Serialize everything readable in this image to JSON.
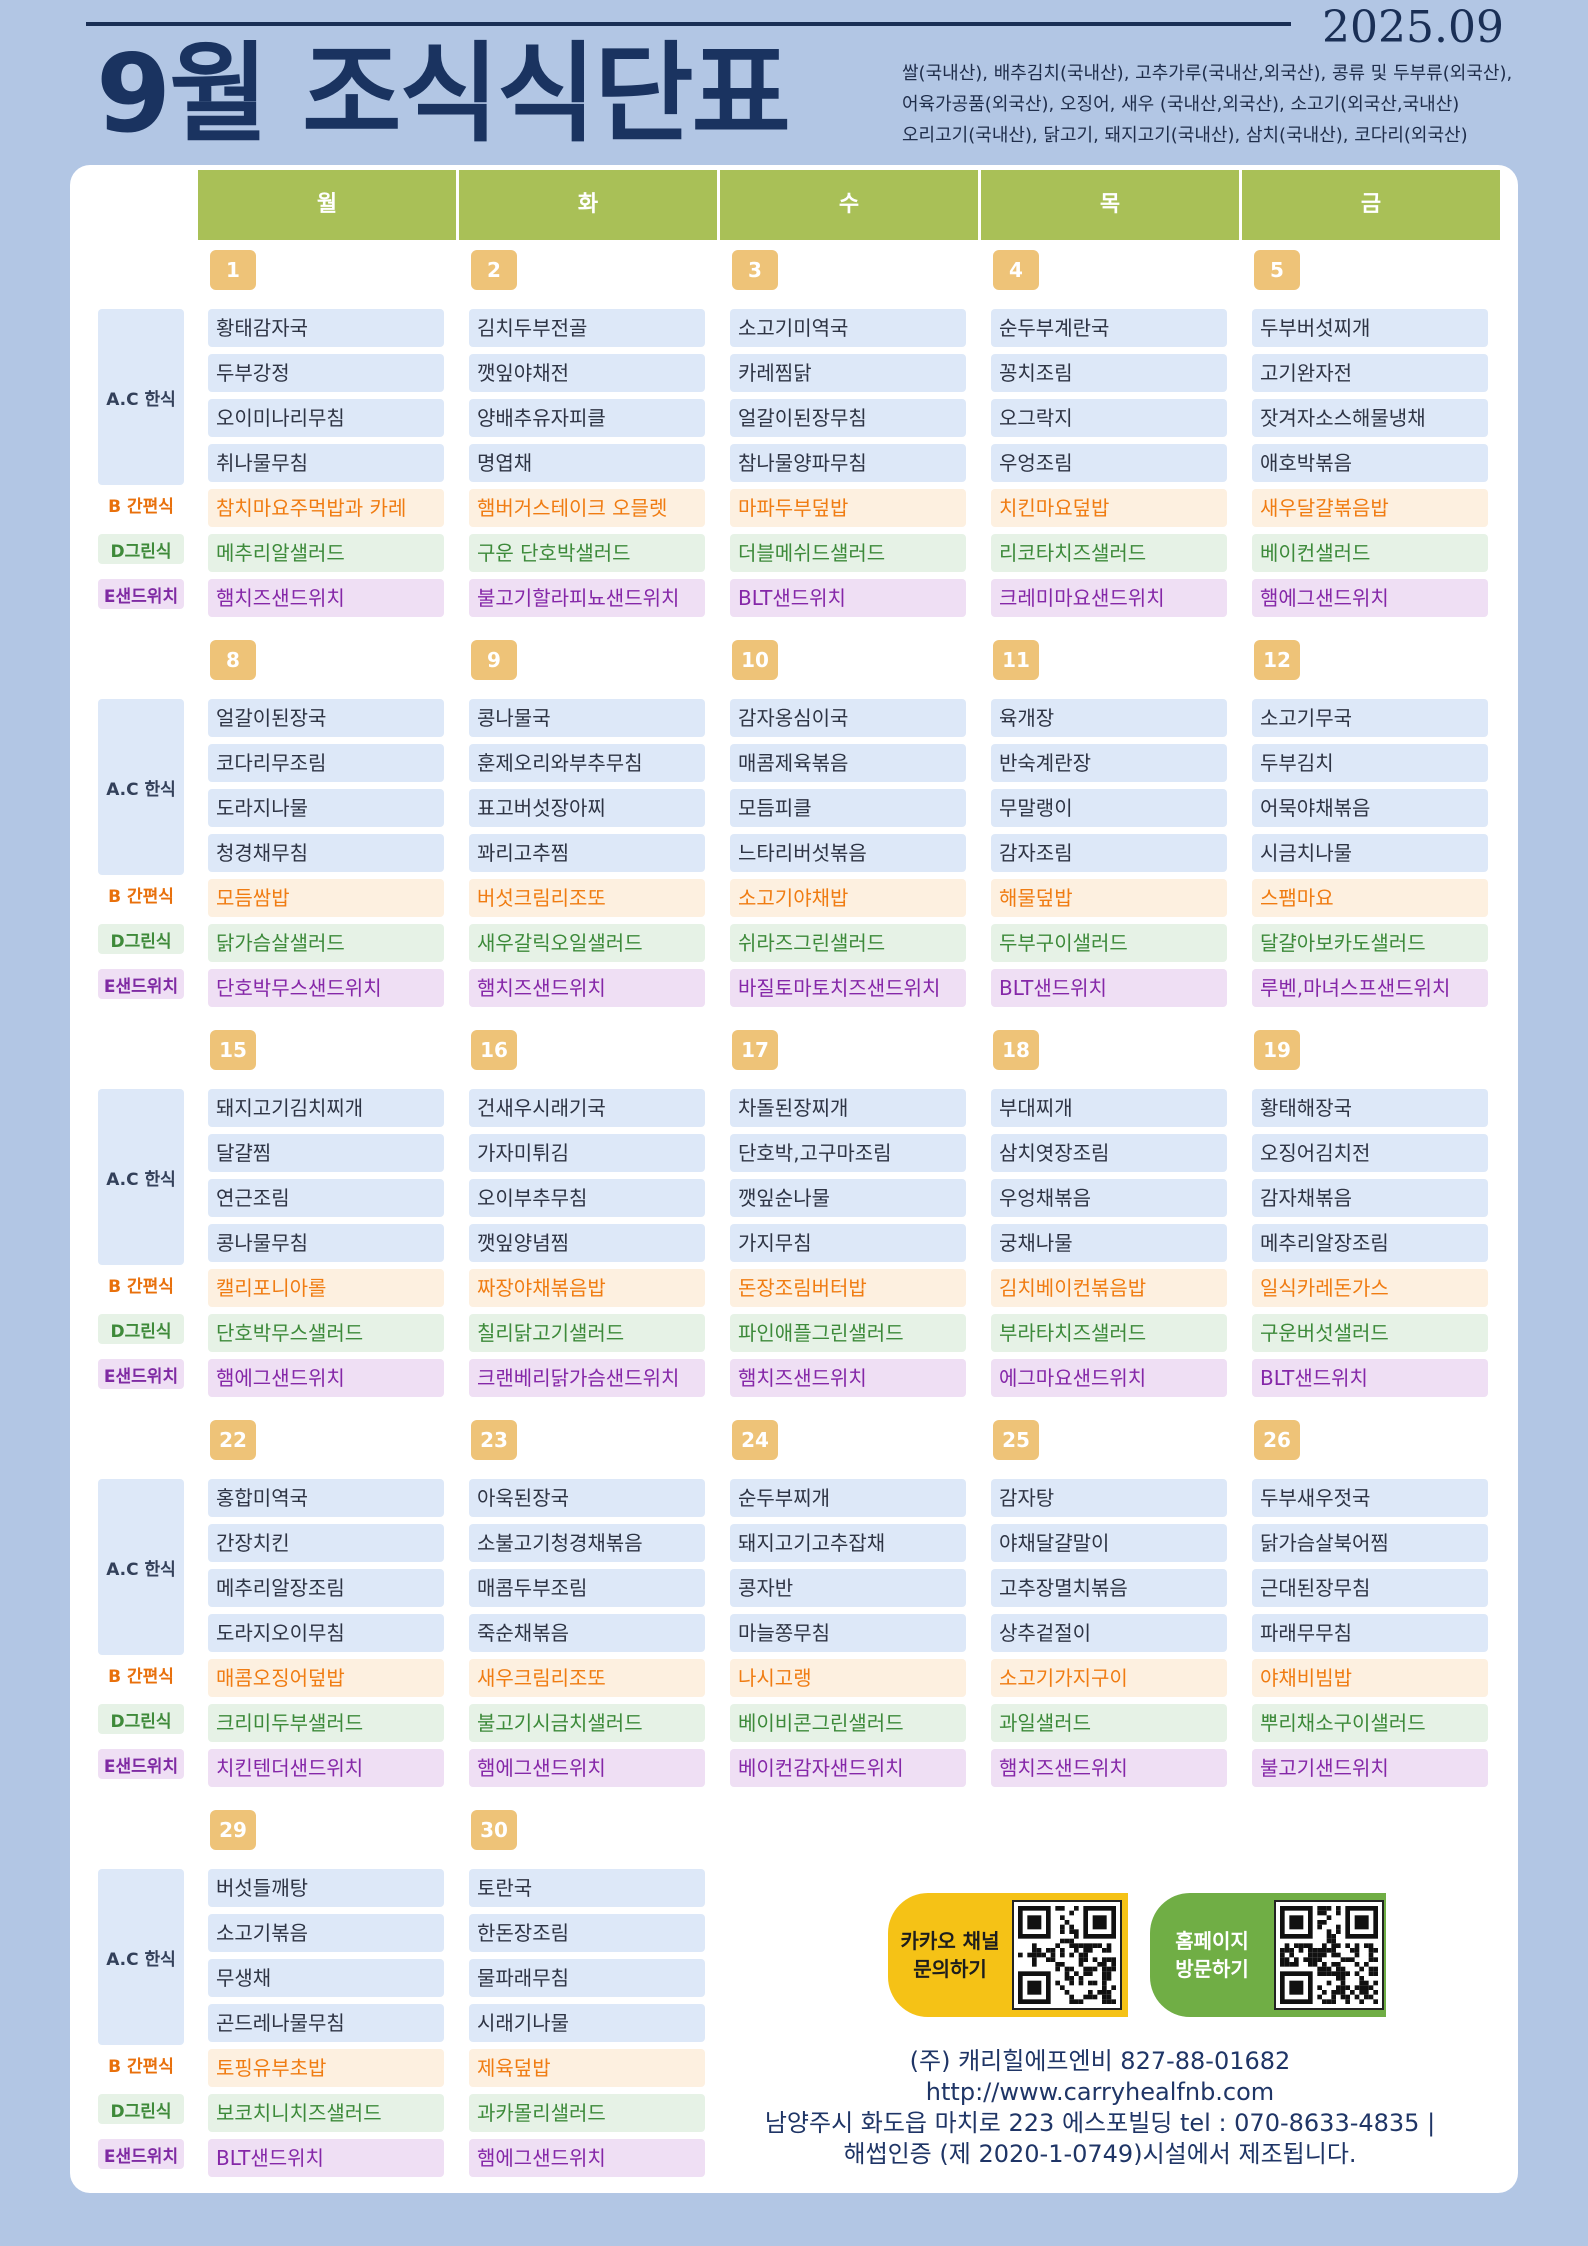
{
  "header": {
    "year_month": "2025.09",
    "title": "9월 조식식단표",
    "origin_lines": [
      "쌀(국내산), 배추김치(국내산), 고추가루(국내산,외국산), 콩류 및 두부류(외국산),",
      "어육가공품(외국산), 오징어, 새우 (국내산,외국산), 소고기(외국산,국내산)",
      "오리고기(국내산), 닭고기, 돼지고기(국내산), 삼치(국내산), 코다리(외국산)"
    ]
  },
  "days": [
    "월",
    "화",
    "수",
    "목",
    "금"
  ],
  "side_labels": {
    "ac": "A.C 한식",
    "b": "B 간편식",
    "d": "D그린식",
    "e": "E샌드위치"
  },
  "weeks": [
    {
      "dates": [
        "1",
        "2",
        "3",
        "4",
        "5"
      ],
      "ac": [
        [
          "황태감자국",
          "두부강정",
          "오이미나리무침",
          "취나물무침"
        ],
        [
          "김치두부전골",
          "깻잎야채전",
          "양배추유자피클",
          "명엽채"
        ],
        [
          "소고기미역국",
          "카레찜닭",
          "얼갈이된장무침",
          "참나물양파무침"
        ],
        [
          "순두부계란국",
          "꽁치조림",
          "오그락지",
          "우엉조림"
        ],
        [
          "두부버섯찌개",
          "고기완자전",
          "잣겨자소스해물냉채",
          "애호박볶음"
        ]
      ],
      "b": [
        "참치마요주먹밥과 카레",
        "햄버거스테이크 오믈렛",
        "마파두부덮밥",
        "치킨마요덮밥",
        "새우달걀볶음밥"
      ],
      "d": [
        "메추리알샐러드",
        "구운 단호박샐러드",
        "더블메쉬드샐러드",
        "리코타치즈샐러드",
        "베이컨샐러드"
      ],
      "e": [
        "햄치즈샌드위치",
        "불고기할라피뇨샌드위치",
        "BLT샌드위치",
        "크레미마요샌드위치",
        "햄에그샌드위치"
      ]
    },
    {
      "dates": [
        "8",
        "9",
        "10",
        "11",
        "12"
      ],
      "ac": [
        [
          "얼갈이된장국",
          "코다리무조림",
          "도라지나물",
          "청경채무침"
        ],
        [
          "콩나물국",
          "훈제오리와부추무침",
          "표고버섯장아찌",
          "꽈리고추찜"
        ],
        [
          "감자옹심이국",
          "매콤제육볶음",
          "모듬피클",
          "느타리버섯볶음"
        ],
        [
          "육개장",
          "반숙계란장",
          "무말랭이",
          "감자조림"
        ],
        [
          "소고기무국",
          "두부김치",
          "어묵야채볶음",
          "시금치나물"
        ]
      ],
      "b": [
        "모듬쌈밥",
        "버섯크림리조또",
        "소고기야채밥",
        "해물덮밥",
        "스팸마요"
      ],
      "d": [
        "닭가슴살샐러드",
        "새우갈릭오일샐러드",
        "쉬라즈그린샐러드",
        "두부구이샐러드",
        "달걀아보카도샐러드"
      ],
      "e": [
        "단호박무스샌드위치",
        "햄치즈샌드위치",
        "바질토마토치즈샌드위치",
        "BLT샌드위치",
        "루벤,마녀스프샌드위치"
      ]
    },
    {
      "dates": [
        "15",
        "16",
        "17",
        "18",
        "19"
      ],
      "ac": [
        [
          "돼지고기김치찌개",
          "달걀찜",
          "연근조림",
          "콩나물무침"
        ],
        [
          "건새우시래기국",
          "가자미튀김",
          "오이부추무침",
          "깻잎양념찜"
        ],
        [
          "차돌된장찌개",
          "단호박,고구마조림",
          "깻잎순나물",
          "가지무침"
        ],
        [
          "부대찌개",
          "삼치엿장조림",
          "우엉채볶음",
          "궁채나물"
        ],
        [
          "황태해장국",
          "오징어김치전",
          "감자채볶음",
          "메추리알장조림"
        ]
      ],
      "b": [
        "캘리포니아롤",
        "짜장야채볶음밥",
        "돈장조림버터밥",
        "김치베이컨볶음밥",
        "일식카레돈가스"
      ],
      "d": [
        "단호박무스샐러드",
        "칠리닭고기샐러드",
        "파인애플그린샐러드",
        "부라타치즈샐러드",
        "구운버섯샐러드"
      ],
      "e": [
        "햄에그샌드위치",
        "크랜베리닭가슴샌드위치",
        "햄치즈샌드위치",
        "에그마요샌드위치",
        "BLT샌드위치"
      ]
    },
    {
      "dates": [
        "22",
        "23",
        "24",
        "25",
        "26"
      ],
      "ac": [
        [
          "홍합미역국",
          "간장치킨",
          "메추리알장조림",
          "도라지오이무침"
        ],
        [
          "아욱된장국",
          "소불고기청경채볶음",
          "매콤두부조림",
          "죽순채볶음"
        ],
        [
          "순두부찌개",
          "돼지고기고추잡채",
          "콩자반",
          "마늘쫑무침"
        ],
        [
          "감자탕",
          "야채달걀말이",
          "고추장멸치볶음",
          "상추겉절이"
        ],
        [
          "두부새우젓국",
          "닭가슴살북어찜",
          "근대된장무침",
          "파래무무침"
        ]
      ],
      "b": [
        "매콤오징어덮밥",
        "새우크림리조또",
        "나시고랭",
        "소고기가지구이",
        "야채비빔밥"
      ],
      "d": [
        "크리미두부샐러드",
        "불고기시금치샐러드",
        "베이비콘그린샐러드",
        "과일샐러드",
        "뿌리채소구이샐러드"
      ],
      "e": [
        "치킨텐더샌드위치",
        "햄에그샌드위치",
        "베이컨감자샌드위치",
        "햄치즈샌드위치",
        "불고기샌드위치"
      ]
    },
    {
      "dates": [
        "29",
        "30"
      ],
      "ac": [
        [
          "버섯들깨탕",
          "소고기볶음",
          "무생채",
          "곤드레나물무침"
        ],
        [
          "토란국",
          "한돈장조림",
          "물파래무침",
          "시래기나물"
        ]
      ],
      "b": [
        "토핑유부초밥",
        "제육덮밥"
      ],
      "d": [
        "보코치니치즈샐러드",
        "과카몰리샐러드"
      ],
      "e": [
        "BLT샌드위치",
        "햄에그샌드위치"
      ]
    }
  ],
  "qr": {
    "kakao_label_1": "카카오 채널",
    "kakao_label_2": "문의하기",
    "home_label_1": "홈페이지",
    "home_label_2": "방문하기"
  },
  "company": {
    "line1": "(주) 캐리힐에프엔비 827-88-01682 http://www.carryhealfnb.com",
    "line2": "남양주시 화도읍 마치로 223 에스포빌딩 tel : 070-8633-4835 |",
    "line3": "해썹인증 (제 2020-1-0749)시설에서 제조됩니다."
  },
  "colors": {
    "background": "#b2c6e4",
    "day_header": "#a9c057",
    "date_badge": "#eec378",
    "kakao": "#f5c216",
    "homepage": "#70ae45"
  }
}
